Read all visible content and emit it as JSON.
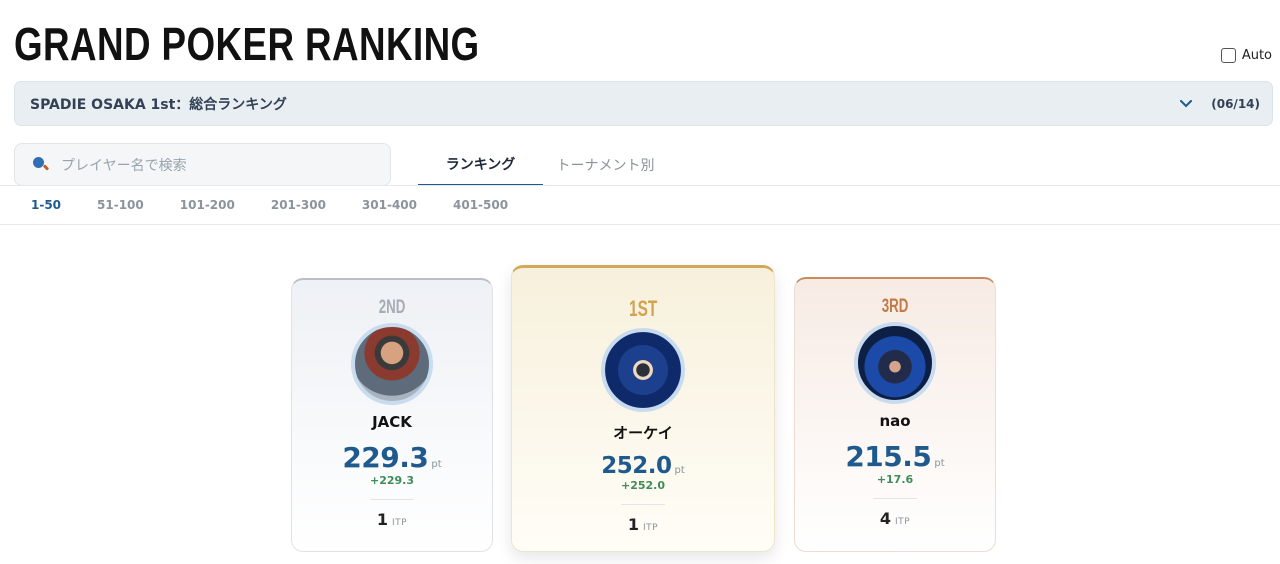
{
  "header": {
    "title": "GRAND POKER RANKING",
    "auto_label": "Auto"
  },
  "event_select": {
    "value": "SPADIE OSAKA 1st：総合ランキング",
    "counter": "(06/14)"
  },
  "search": {
    "placeholder": "プレイヤー名で検索"
  },
  "tabs": [
    {
      "label": "ランキング",
      "active": true
    },
    {
      "label": "トーナメント別",
      "active": false
    }
  ],
  "ranges": [
    "1-50",
    "51-100",
    "101-200",
    "201-300",
    "301-400",
    "401-500"
  ],
  "podium": {
    "second": {
      "rank": "2ND",
      "name": "JACK",
      "points": "229.3",
      "unit": "pt",
      "delta": "+229.3",
      "itp": "1",
      "itp_unit": "ITP"
    },
    "first": {
      "rank": "1ST",
      "name": "オーケイ",
      "points": "252.0",
      "unit": "pt",
      "delta": "+252.0",
      "itp": "1",
      "itp_unit": "ITP"
    },
    "third": {
      "rank": "3RD",
      "name": "nao",
      "points": "215.5",
      "unit": "pt",
      "delta": "+17.6",
      "itp": "4",
      "itp_unit": "ITP"
    }
  },
  "colors": {
    "accent": "#1e5a8e",
    "gold": "#d2a24f",
    "silver": "#a6acb4",
    "bronze": "#c27a47",
    "positive": "#3f8b5a"
  }
}
